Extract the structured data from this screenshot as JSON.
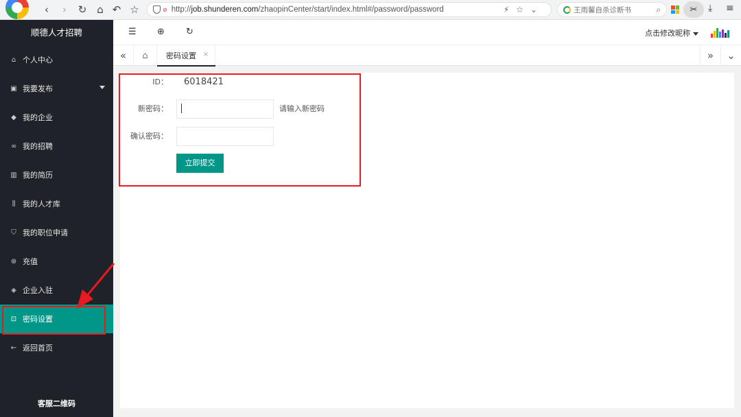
{
  "browser": {
    "url_prefix": "http://",
    "url_domain": "job.shunderen.com",
    "url_path": "/zhaopinCenter/start/index.html#/password/password",
    "search_placeholder": "王雨馨自杀诊断书",
    "nosec_text": "⊘"
  },
  "sidebar": {
    "title": "顺德人才招聘",
    "items": [
      {
        "label": "个人中心",
        "icon": "home-icon"
      },
      {
        "label": "我要发布",
        "icon": "publish-icon"
      },
      {
        "label": "我的企业",
        "icon": "layers-icon"
      },
      {
        "label": "我的招聘",
        "icon": "link-icon"
      },
      {
        "label": "我的简历",
        "icon": "book-icon"
      },
      {
        "label": "我的人才库",
        "icon": "library-icon"
      },
      {
        "label": "我的职位申请",
        "icon": "shield-check-icon"
      },
      {
        "label": "充值",
        "icon": "coin-icon"
      },
      {
        "label": "企业入驻",
        "icon": "diamond-icon"
      },
      {
        "label": "密码设置",
        "icon": "lock-icon"
      },
      {
        "label": "返回首页",
        "icon": "arrow-left-icon"
      }
    ],
    "footer": "客服二维码"
  },
  "header": {
    "nickname": "点击修改昵称"
  },
  "tabs": {
    "current": "密码设置",
    "close_glyph": "×"
  },
  "form": {
    "id_label": "ID：",
    "id_value": "6018421",
    "new_password_label": "新密码：",
    "new_password_hint": "请输入新密码",
    "confirm_password_label": "确认密码：",
    "submit_label": "立即提交"
  },
  "colors": {
    "sidebar_bg": "#20222a",
    "accent": "#009688",
    "annotation": "#e8191f"
  }
}
